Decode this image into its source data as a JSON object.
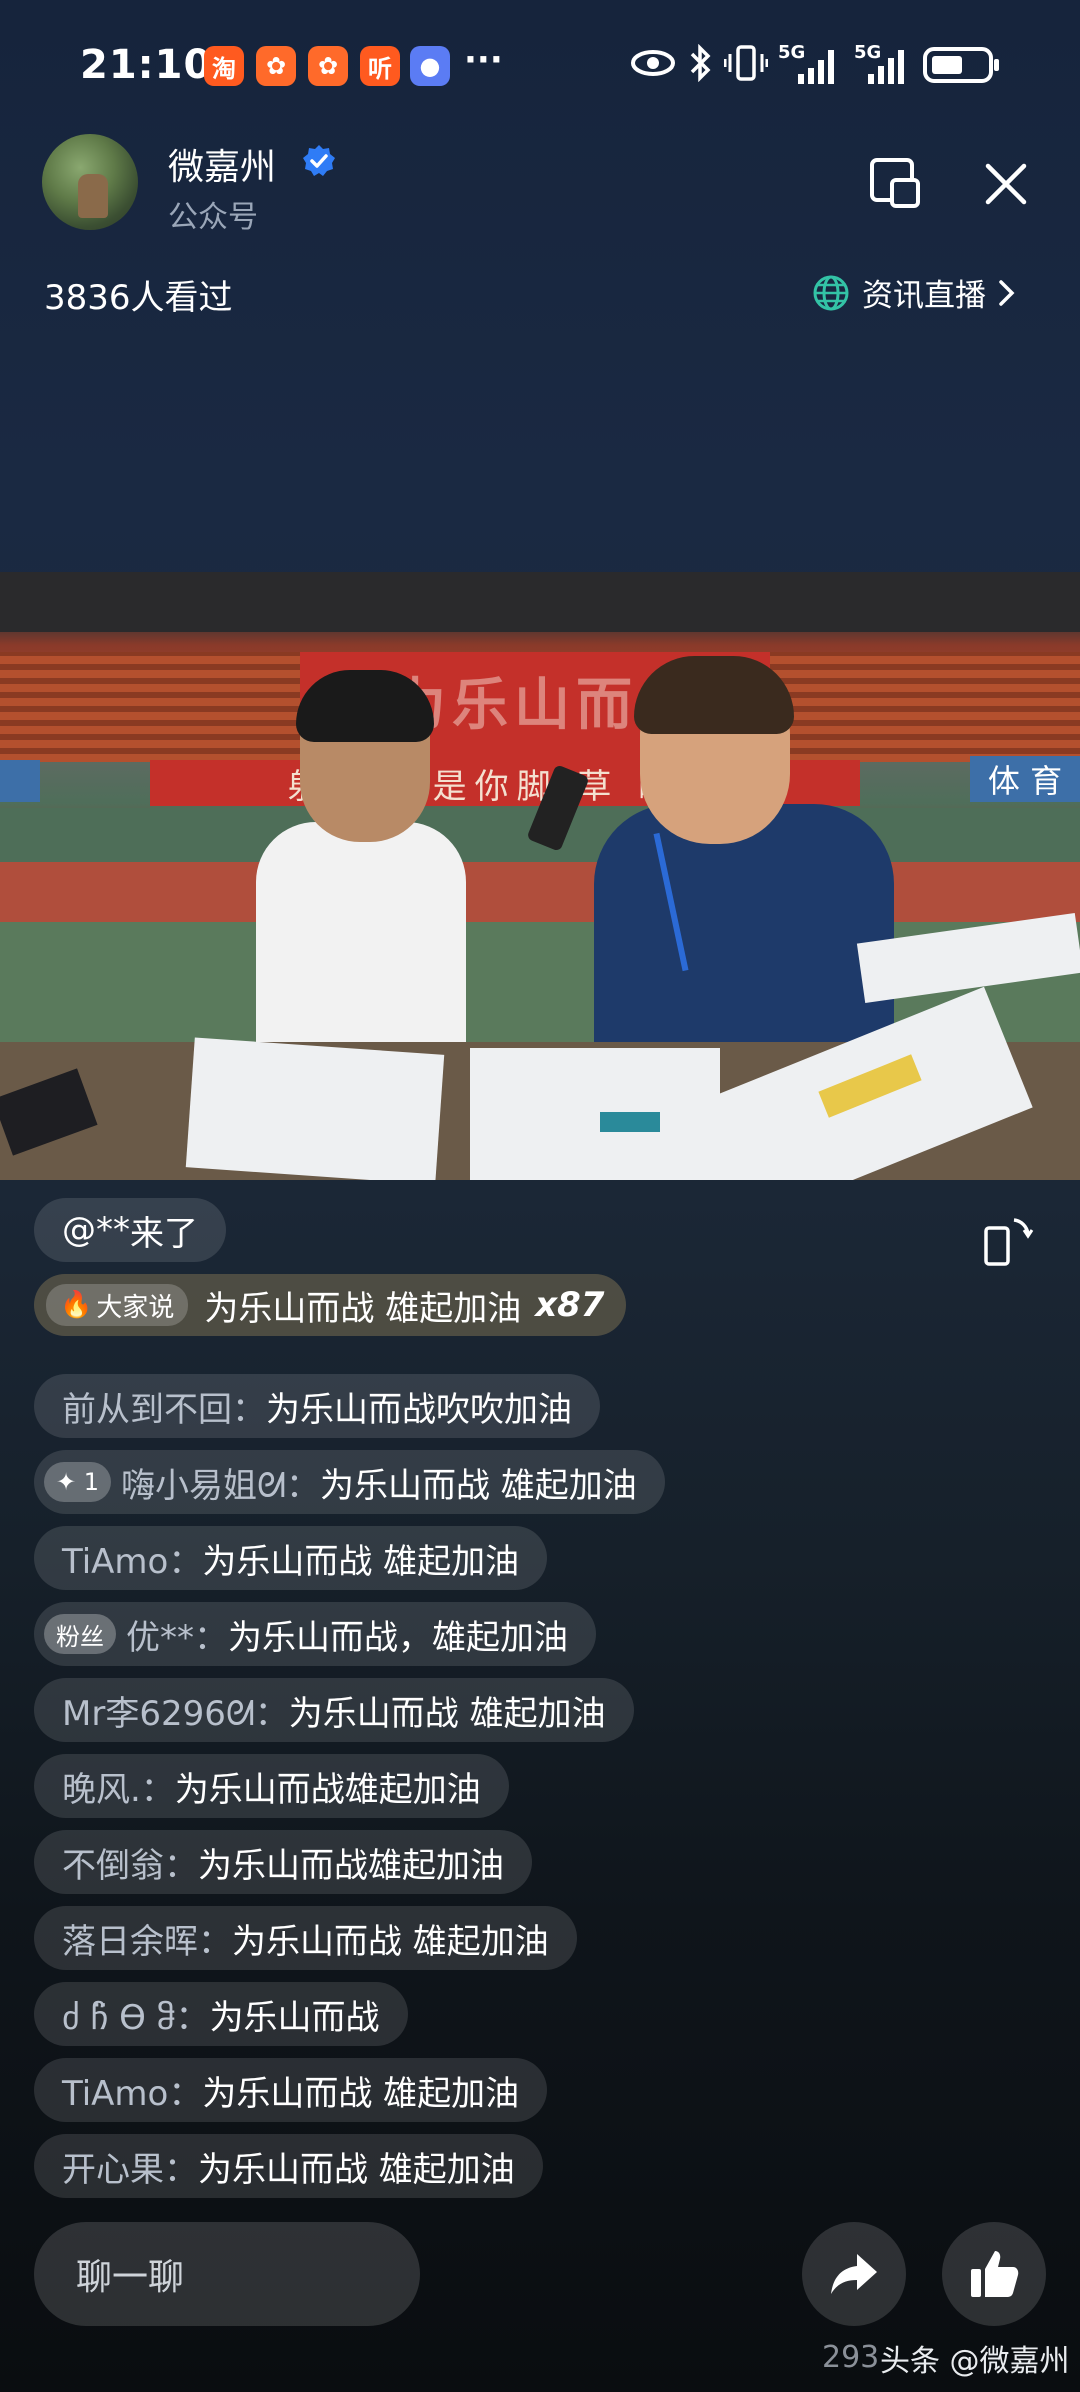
{
  "status_bar": {
    "time": "21:10",
    "app_icons": [
      {
        "icon": "taobao-icon",
        "glyph": "淘",
        "color": "#ff5a1f"
      },
      {
        "icon": "app-grid-icon-1",
        "glyph": "◎",
        "color": "#ff6a2a"
      },
      {
        "icon": "app-grid-icon-2",
        "glyph": "◎",
        "color": "#ff6a2a"
      },
      {
        "icon": "ting-icon",
        "glyph": "听",
        "color": "#ff5a1f"
      },
      {
        "icon": "chat-bubble-icon",
        "glyph": "…",
        "color": "#5b7cf4"
      }
    ],
    "more": "···",
    "network_labels": [
      "5G",
      "5G"
    ]
  },
  "header": {
    "account_name": "微嘉州",
    "account_type": "公众号",
    "viewer_count": "3836人看过",
    "category_label": "资讯直播"
  },
  "video": {
    "banner_text": "射王不  是你脚    草    瞬间",
    "banner_side": "体 育",
    "stand_text": "为乐山而战"
  },
  "chat": {
    "arrival": {
      "user": "@**",
      "text": " 来了"
    },
    "hot_comment": {
      "tag": "大家说",
      "text": "为乐山而战 雄起加油",
      "count": "x87"
    },
    "messages": [
      {
        "badge": "",
        "user": "前从到不回：",
        "text": "为乐山而战吹吹加油"
      },
      {
        "badge": "✦ 1",
        "user": "嗨小易姐ᘛ：",
        "text": "为乐山而战 雄起加油"
      },
      {
        "badge": "",
        "user": "TiAmo：",
        "text": "为乐山而战 雄起加油"
      },
      {
        "badge": "粉丝",
        "user": "优**：",
        "text": "为乐山而战，雄起加油"
      },
      {
        "badge": "",
        "user": "Mr李6296ᘛ：",
        "text": "为乐山而战 雄起加油"
      },
      {
        "badge": "",
        "user": "晚风.：",
        "text": "为乐山而战雄起加油"
      },
      {
        "badge": "",
        "user": "不倒翁：",
        "text": "为乐山而战雄起加油"
      },
      {
        "badge": "",
        "user": "落日余晖：",
        "text": "为乐山而战 雄起加油"
      },
      {
        "badge": "",
        "user": "ძ ჩ̈ Ѳ ჵ：",
        "text": "为乐山而战"
      },
      {
        "badge": "",
        "user": "TiAmo：",
        "text": "为乐山而战 雄起加油"
      },
      {
        "badge": "",
        "user": "开心果：",
        "text": "为乐山而战 雄起加油"
      }
    ]
  },
  "bottom_bar": {
    "input_placeholder": "聊一聊",
    "like_count_partial": "293",
    "watermark": "头条 @微嘉州"
  }
}
